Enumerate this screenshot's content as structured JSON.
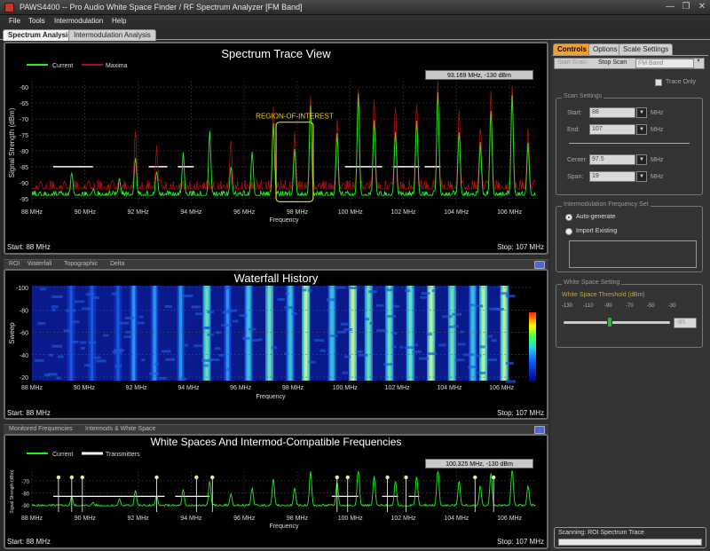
{
  "window": {
    "title": "PAWS4400 -- Pro Audio White Space Finder / RF Spectrum Analyzer  [FM Band]",
    "minimize": "—",
    "restore": "❐",
    "close": "✕"
  },
  "menu": [
    "File",
    "Tools",
    "Intermodulation",
    "Help"
  ],
  "tabs": [
    "Spectrum Analysis",
    "Intermodulation Analysis"
  ],
  "spectrum": {
    "title": "Spectrum Trace View",
    "legend": [
      "Current",
      "Maxima"
    ],
    "readout": "93.169 MHz,  -130 dBm",
    "roi_label": "REGION-OF-INTEREST",
    "ylabel": "Signal Strength (dBm)",
    "xlabel": "Frequency",
    "start": "Start: 88 MHz",
    "stop": "Stop: 107 MHz"
  },
  "waterfall": {
    "subtabs": [
      "ROI",
      "Waterfall",
      "Topographic",
      "Delta"
    ],
    "title": "Waterfall History",
    "ylabel": "Sweep",
    "xlabel": "Frequency",
    "start": "Start: 88 MHz",
    "stop": "Stop: 107 MHz"
  },
  "whitespace": {
    "subtabs": [
      "Monitored Frequencies",
      "Intermods & White Space"
    ],
    "title": "White Spaces And Intermod-Compatible Frequencies",
    "legend": [
      "Current",
      "Transmitters"
    ],
    "readout": "100.325 MHz,  -130 dBm",
    "ylabel": "Signal Strength (dBm)",
    "xlabel": "Frequency",
    "start": "Start: 88 MHz",
    "stop": "Stop: 107 MHz"
  },
  "controls": {
    "tabs": [
      "Controls",
      "Options",
      "Scale Settings"
    ],
    "start_scan": "Start Scan",
    "stop_scan": "Stop Scan",
    "band_select": "FM Band",
    "trace_only": "Trace Only",
    "scan_settings": {
      "title": "Scan Settings",
      "start_label": "Start:",
      "start_value": "88",
      "start_unit": "MHz",
      "end_label": "End:",
      "end_value": "107",
      "end_unit": "MHz",
      "center_label": "Center:",
      "center_value": "97.5",
      "center_unit": "MHz",
      "span_label": "Span:",
      "span_value": "19",
      "span_unit": "MHz"
    },
    "intermod": {
      "title": "Intermodulation Frequency Set",
      "auto": "Auto-generate",
      "import": "Import Existing"
    },
    "whitespace": {
      "title": "White Space Setting",
      "threshold_label": "White Space Threshold (dBm)",
      "ticks": [
        "-130",
        "-110",
        "-90",
        "-70",
        "-50",
        "-30"
      ],
      "threshold_value": "-85",
      "threshold_fraction": 0.43
    },
    "status": {
      "text": "Scanning: ROI Spectrum Trace",
      "progress": 0
    }
  },
  "chart_data": [
    {
      "type": "line",
      "title": "Spectrum Trace View",
      "xlabel": "Frequency",
      "ylabel": "Signal Strength (dBm)",
      "x_ticks": [
        "88 MHz",
        "90 MHz",
        "92 MHz",
        "94 MHz",
        "96 MHz",
        "98 MHz",
        "100 MHz",
        "102 MHz",
        "104 MHz",
        "106 MHz"
      ],
      "y_ticks": [
        "-60",
        "-65",
        "-70",
        "-75",
        "-80",
        "-85",
        "-90",
        "-95"
      ],
      "xlim": [
        88,
        107
      ],
      "ylim": [
        -97,
        -58
      ],
      "noise_floor": -94,
      "series": [
        {
          "name": "Current",
          "color": "#22ee22"
        },
        {
          "name": "Maxima",
          "color": "#aa1111"
        }
      ],
      "peaks": [
        [
          89.5,
          -87
        ],
        [
          90.3,
          -92
        ],
        [
          91.3,
          -89
        ],
        [
          91.9,
          -82
        ],
        [
          92.7,
          -86
        ],
        [
          93.7,
          -81
        ],
        [
          94.7,
          -74
        ],
        [
          95.5,
          -85
        ],
        [
          96.3,
          -80
        ],
        [
          97.1,
          -72
        ],
        [
          97.9,
          -80
        ],
        [
          98.5,
          -66
        ],
        [
          99.5,
          -75
        ],
        [
          100.3,
          -62
        ],
        [
          100.9,
          -70
        ],
        [
          101.7,
          -74
        ],
        [
          102.5,
          -70
        ],
        [
          103.3,
          -62
        ],
        [
          104.1,
          -74
        ],
        [
          104.9,
          -78
        ],
        [
          105.3,
          -67
        ],
        [
          106.1,
          -63
        ],
        [
          106.7,
          -78
        ]
      ],
      "maxima_peaks": [
        [
          91.9,
          -74
        ],
        [
          92.7,
          -79
        ],
        [
          95.5,
          -77
        ],
        [
          97.1,
          -66
        ],
        [
          97.9,
          -74
        ],
        [
          98.5,
          -62
        ],
        [
          99.5,
          -70
        ],
        [
          100.3,
          -60
        ],
        [
          100.9,
          -64
        ],
        [
          101.7,
          -66
        ],
        [
          102.5,
          -65
        ],
        [
          103.3,
          -59
        ],
        [
          104.1,
          -68
        ],
        [
          104.9,
          -72
        ],
        [
          105.3,
          -62
        ],
        [
          106.1,
          -59
        ],
        [
          106.7,
          -73
        ]
      ],
      "threshold": -85,
      "white_space_segments": [
        [
          88.8,
          90.3
        ],
        [
          92.4,
          93.1
        ],
        [
          93.5,
          94.1
        ],
        [
          99.8,
          101.2
        ],
        [
          101.6,
          102.6
        ],
        [
          102.8,
          103.4
        ]
      ],
      "roi": [
        97.2,
        98.6
      ]
    },
    {
      "type": "heatmap",
      "title": "Waterfall History",
      "xlabel": "Frequency",
      "ylabel": "Sweep",
      "y_ticks": [
        "-100",
        "-80",
        "-60",
        "-40",
        "-20"
      ],
      "x_ticks": [
        "88 MHz",
        "90 MHz",
        "92 MHz",
        "94 MHz",
        "96 MHz",
        "98 MHz",
        "100 MHz",
        "102 MHz",
        "104 MHz",
        "106 MHz"
      ],
      "xlim": [
        88,
        106.3
      ]
    },
    {
      "type": "line",
      "title": "White Spaces And Intermod-Compatible Frequencies",
      "xlabel": "Frequency",
      "ylabel": "Signal Strength (dBm)",
      "y_ticks": [
        "-70",
        "-80",
        "-90"
      ],
      "x_ticks": [
        "88 MHz",
        "90 MHz",
        "92 MHz",
        "94 MHz",
        "96 MHz",
        "98 MHz",
        "100 MHz",
        "102 MHz",
        "104 MHz",
        "106 MHz"
      ],
      "xlim": [
        88,
        107
      ],
      "ylim": [
        -96,
        -62
      ],
      "transmitters": [
        89.0,
        89.5,
        89.9,
        92.7,
        94.2,
        94.8,
        99.5,
        99.9,
        101.4,
        102.1,
        104.7,
        105.4
      ],
      "white_space_segments": [
        [
          88.8,
          93.0
        ],
        [
          93.4,
          94.7
        ],
        [
          99.3,
          100.3
        ],
        [
          101.2,
          101.8
        ],
        [
          102.2,
          102.6
        ]
      ]
    }
  ]
}
